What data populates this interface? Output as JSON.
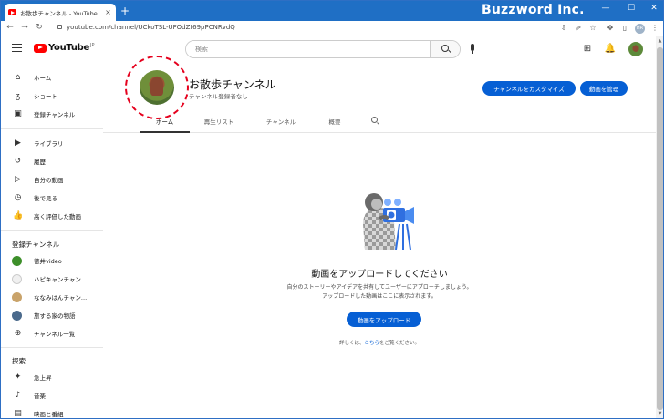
{
  "browser": {
    "tab_title": "お散歩チャンネル - YouTube",
    "tab_close": "×",
    "new_tab": "+",
    "url": "youtube.com/channel/UCkoTSL-UFOdZt69pPCNRvdQ",
    "profile_initials": "HR",
    "window_controls": [
      "—",
      "☐",
      "✕"
    ]
  },
  "watermark": "Buzzword Inc.",
  "youtube": {
    "logo_text": "YouTube",
    "logo_suffix": "JP",
    "search_placeholder": "検索"
  },
  "sidebar": {
    "main_items": [
      {
        "label": "ホーム",
        "icon": "home-icon",
        "glyph": "⌂"
      },
      {
        "label": "ショート",
        "icon": "shorts-icon",
        "glyph": "ᵹ"
      },
      {
        "label": "登録チャンネル",
        "icon": "subscriptions-icon",
        "glyph": "▣"
      }
    ],
    "library_items": [
      {
        "label": "ライブラリ",
        "icon": "library-icon",
        "glyph": "▶"
      },
      {
        "label": "履歴",
        "icon": "history-icon",
        "glyph": "↺"
      },
      {
        "label": "自分の動画",
        "icon": "your-videos-icon",
        "glyph": "▷"
      },
      {
        "label": "後で見る",
        "icon": "watch-later-icon",
        "glyph": "◷"
      },
      {
        "label": "高く評価した動画",
        "icon": "liked-videos-icon",
        "glyph": "👍"
      }
    ],
    "subscriptions_title": "登録チャンネル",
    "subscriptions": [
      {
        "label": "徳井video",
        "color": "#3d8f2a"
      },
      {
        "label": "ハピキャンチャン...",
        "color": "#f0f0f0"
      },
      {
        "label": "ななみはんチャン...",
        "color": "#c9a36a"
      },
      {
        "label": "旅する家の物語",
        "color": "#4b6a8c"
      }
    ],
    "browse_channels": "チャンネル一覧",
    "explore_title": "探索",
    "explore_items": [
      {
        "label": "急上昇",
        "icon": "trending-icon",
        "glyph": "✦"
      },
      {
        "label": "音楽",
        "icon": "music-icon",
        "glyph": "♪"
      },
      {
        "label": "映画と番組",
        "icon": "movies-icon",
        "glyph": "▤"
      }
    ]
  },
  "channel": {
    "name": "お散歩チャンネル",
    "subscribers": "チャンネル登録者なし",
    "customize_button": "チャンネルをカスタマイズ",
    "manage_button": "動画を管理",
    "tabs": [
      "ホーム",
      "再生リスト",
      "チャンネル",
      "概要"
    ]
  },
  "empty_state": {
    "title": "動画をアップロードしてください",
    "desc_line1": "自分のストーリーやアイデアを共有してユーザーにアプローチしましょう。",
    "desc_line2": "アップロードした動画はここに表示されます。",
    "upload_button": "動画をアップロード",
    "learn_prefix": "詳しくは、",
    "learn_link": "こちら",
    "learn_suffix": "をご覧ください。"
  },
  "colors": {
    "accent": "#065fd4",
    "titlebar": "#1f6fc5",
    "highlight": "#e5001d",
    "youtube_red": "#ff0000"
  }
}
